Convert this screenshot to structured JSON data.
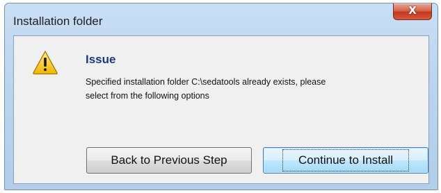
{
  "window": {
    "title": "Installation folder",
    "close_label": "X"
  },
  "dialog": {
    "icon": "warning-icon",
    "heading": "Issue",
    "message": "Specified installation folder C:\\sedatools already exists, please\nselect from the following options"
  },
  "buttons": {
    "back_label": "Back to Previous Step",
    "continue_label": "Continue to Install"
  },
  "colors": {
    "heading": "#1a3a7a",
    "close_red": "#c3381c",
    "warning_yellow": "#f5c518"
  }
}
